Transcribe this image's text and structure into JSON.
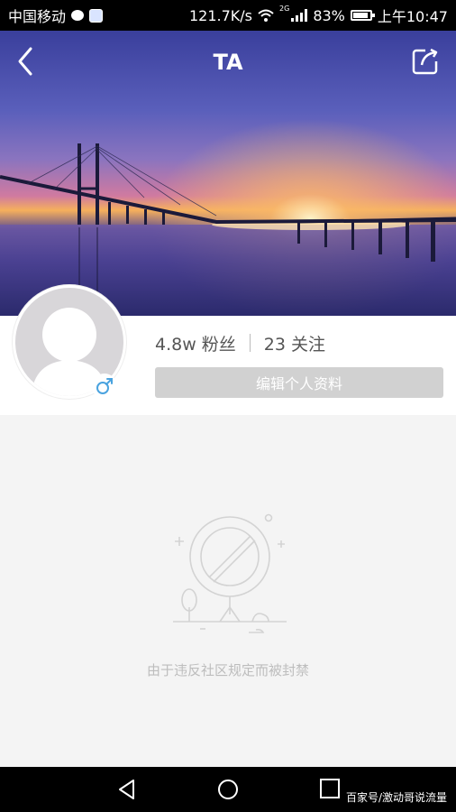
{
  "status_bar": {
    "carrier": "中国移动",
    "speed": "121.7K/s",
    "network": "2G",
    "battery": "83%",
    "time": "上午10:47"
  },
  "header": {
    "title": "TA",
    "back_icon": "chevron-left-icon",
    "share_icon": "share-icon"
  },
  "profile": {
    "fans": "4.8w 粉丝",
    "following": "23 关注",
    "edit_label": "编辑个人资料",
    "gender_icon": "male-icon"
  },
  "empty_state": {
    "message": "由于违反社区规定而被封禁"
  },
  "nav": {
    "watermark": "百家号/激动哥说流量"
  },
  "colors": {
    "edit_button_bg": "#d1d1d1",
    "gender_blue": "#4aa3df",
    "empty_text": "#bdbdbd"
  }
}
